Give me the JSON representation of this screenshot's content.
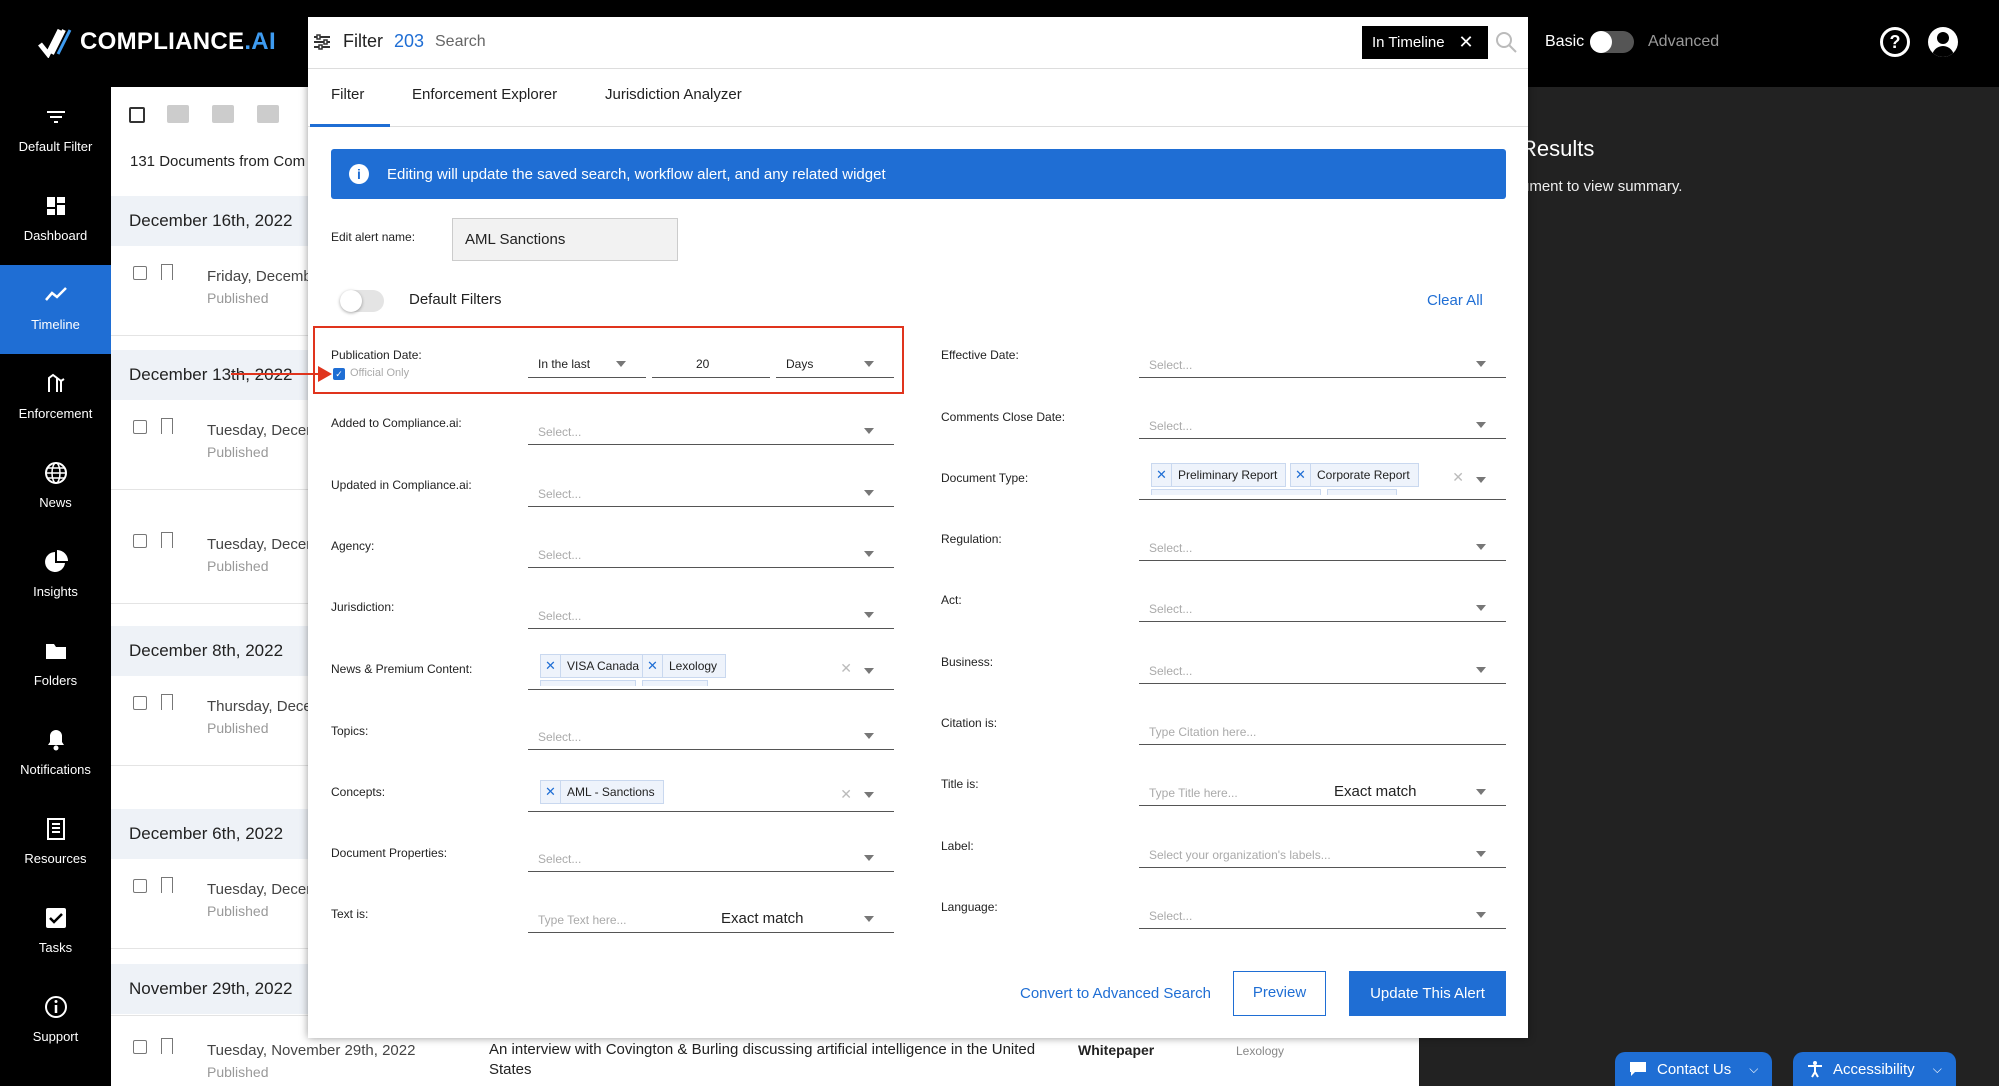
{
  "app": {
    "brand_main": "COMPLIANCE",
    "brand_suffix": ".AI"
  },
  "header": {
    "basic_label": "Basic",
    "advanced_label": "Advanced"
  },
  "sidebar": {
    "items": [
      {
        "label": "Default Filter",
        "icon": "filter-lines-icon"
      },
      {
        "label": "Dashboard",
        "icon": "grid-icon"
      },
      {
        "label": "Timeline",
        "icon": "trend-line-icon"
      },
      {
        "label": "Enforcement",
        "icon": "gavel-icon"
      },
      {
        "label": "News",
        "icon": "globe-icon"
      },
      {
        "label": "Insights",
        "icon": "pie-chart-icon"
      },
      {
        "label": "Folders",
        "icon": "folder-icon"
      },
      {
        "label": "Notifications",
        "icon": "bell-icon"
      },
      {
        "label": "Resources",
        "icon": "book-icon"
      },
      {
        "label": "Tasks",
        "icon": "checkbox-icon"
      },
      {
        "label": "Support",
        "icon": "info-icon"
      }
    ]
  },
  "doclist": {
    "count_text": "131 Documents from Com",
    "groups": [
      {
        "date": "December 16th, 2022"
      },
      {
        "date": "December 13th, 2022"
      },
      {
        "date": "December 8th, 2022"
      },
      {
        "date": "December 6th, 2022"
      },
      {
        "date": "November 29th, 2022"
      }
    ],
    "rows": [
      {
        "title": "Friday, Decemb",
        "status": "Published"
      },
      {
        "title": "Tuesday, Decer",
        "status": "Published"
      },
      {
        "title": "Tuesday, Decer",
        "status": "Published"
      },
      {
        "title": "Thursday, Dece",
        "status": "Published"
      },
      {
        "title": "Tuesday, Decer",
        "status": "Published"
      }
    ],
    "last_row": {
      "title": "Tuesday, November 29th, 2022",
      "status": "Published",
      "description": "An interview with Covington & Burling discussing artificial intelligence in the United States",
      "doc_type": "Whitepaper",
      "source": "Lexology"
    }
  },
  "results": {
    "title": "Results",
    "hint": "ument to view summary."
  },
  "bottom": {
    "contact": "Contact Us",
    "accessibility": "Accessibility"
  },
  "modal": {
    "filter_label": "Filter",
    "filter_count": "203",
    "search_placeholder": "Search",
    "timeline_button": "In Timeline",
    "tabs": [
      "Filter",
      "Enforcement Explorer",
      "Jurisdiction Analyzer"
    ],
    "banner": "Editing will update the saved search, workflow alert, and any related widget",
    "alert_name_label": "Edit alert name:",
    "alert_name_value": "AML Sanctions",
    "default_filters": "Default Filters",
    "clear_all": "Clear All",
    "publication": {
      "label": "Publication Date:",
      "official_only": "Official Only",
      "range": "In the last",
      "amount": "20",
      "unit": "Days"
    },
    "select_placeholder": "Select...",
    "left_fields": {
      "added": "Added to Compliance.ai:",
      "updated": "Updated in Compliance.ai:",
      "agency": "Agency:",
      "jurisdiction": "Jurisdiction:",
      "news": "News & Premium Content:",
      "topics": "Topics:",
      "concepts": "Concepts:",
      "docprops": "Document Properties:",
      "text": "Text is:"
    },
    "right_fields": {
      "effective": "Effective Date:",
      "comments": "Comments Close Date:",
      "doctype": "Document Type:",
      "regulation": "Regulation:",
      "act": "Act:",
      "business": "Business:",
      "citation": "Citation is:",
      "title": "Title is:",
      "label": "Label:",
      "language": "Language:"
    },
    "news_chips": [
      "VISA Canada",
      "Lexology"
    ],
    "concept_chips": [
      "AML - Sanctions"
    ],
    "doctype_chips": [
      "Preliminary Report",
      "Corporate Report"
    ],
    "text_placeholder": "Type Text here...",
    "citation_placeholder": "Type Citation here...",
    "title_placeholder": "Type Title here...",
    "label_placeholder": "Select your organization's labels...",
    "exact_match": "Exact match",
    "convert_link": "Convert to Advanced Search",
    "preview": "Preview",
    "update": "Update This Alert"
  }
}
